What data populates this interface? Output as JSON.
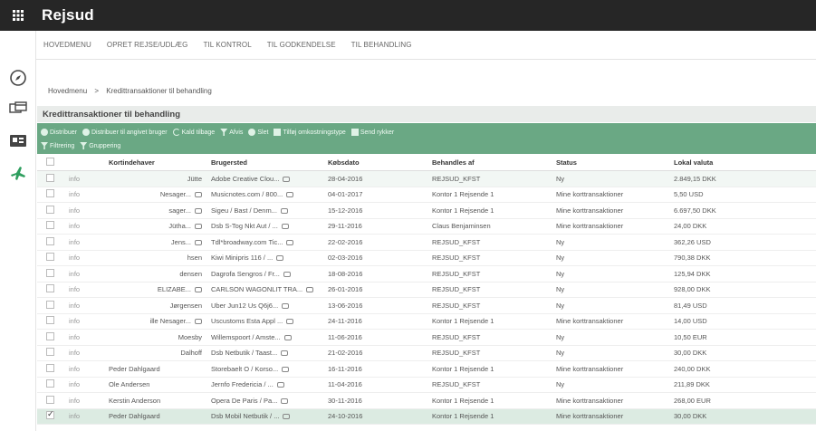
{
  "app": {
    "title": "Rejsud",
    "grid_icon": "grid-icon"
  },
  "menu": {
    "items": [
      "HOVEDMENU",
      "OPRET REJSE/UDLÆG",
      "TIL KONTROL",
      "TIL GODKENDELSE",
      "TIL BEHANDLING"
    ]
  },
  "sidebar": {
    "icons": [
      "compass-icon",
      "cards-icon",
      "card-reader-icon",
      "plane-icon"
    ],
    "accent": "#2e9e5e"
  },
  "breadcrumb": {
    "home": "Hovedmenu",
    "separator": ">",
    "current": "Kredittransaktioner til behandling"
  },
  "panel": {
    "title": "Kredittransaktioner til behandling",
    "toolbar_color": "#6aa884"
  },
  "toolbar": {
    "row1": [
      "Distribuer",
      "Distribuer til angivet bruger",
      "Kald tilbage",
      "Afvis",
      "Slet",
      "Tilføj omkostningstype",
      "Send rykker"
    ],
    "row2": [
      "Filtrering",
      "Gruppering"
    ]
  },
  "table": {
    "headers": [
      "Kortindehaver",
      "Brugersted",
      "Købsdato",
      "Behandles af",
      "Status",
      "Lokal valuta"
    ],
    "rows": [
      {
        "checked": false,
        "info": "info",
        "name": "Jütte",
        "place": "Adobe Creative Clou...",
        "date": "28-04-2016",
        "handler": "REJSUD_KFST",
        "status": "Ny",
        "amount": "2.849,15 DKK"
      },
      {
        "checked": false,
        "info": "info",
        "name": "Nesager...",
        "place": "Musicnotes.com / 800...",
        "date": "04-01-2017",
        "handler": "Kontor 1 Rejsende 1",
        "status": "Mine korttransaktioner",
        "amount": "5,50 USD"
      },
      {
        "checked": false,
        "info": "info",
        "name": "sager...",
        "place": "Sigeu / Bast / Denm...",
        "date": "15-12-2016",
        "handler": "Kontor 1 Rejsende 1",
        "status": "Mine korttransaktioner",
        "amount": "6.697,50 DKK"
      },
      {
        "checked": false,
        "info": "info",
        "name": "Jütha...",
        "place": "Dsb S-Tog Nkt Aut / ...",
        "date": "29-11-2016",
        "handler": "Claus Benjaminsen",
        "status": "Mine korttransaktioner",
        "amount": "24,00 DKK"
      },
      {
        "checked": false,
        "info": "info",
        "name": "Jens...",
        "place": "Tdl*broadway.com Tic...",
        "date": "22-02-2016",
        "handler": "REJSUD_KFST",
        "status": "Ny",
        "amount": "362,26 USD"
      },
      {
        "checked": false,
        "info": "info",
        "name": "hsen",
        "place": "Kiwi Minipris 116 / ...",
        "date": "02-03-2016",
        "handler": "REJSUD_KFST",
        "status": "Ny",
        "amount": "790,38 DKK"
      },
      {
        "checked": false,
        "info": "info",
        "name": "densen",
        "place": "Dagrofa Sengros / Fr...",
        "date": "18-08-2016",
        "handler": "REJSUD_KFST",
        "status": "Ny",
        "amount": "125,94 DKK"
      },
      {
        "checked": false,
        "info": "info",
        "name": "ELIZABE...",
        "place": "CARLSON WAGONLIT TRA...",
        "date": "26-01-2016",
        "handler": "REJSUD_KFST",
        "status": "Ny",
        "amount": "928,00 DKK"
      },
      {
        "checked": false,
        "info": "info",
        "name": "Jørgensen",
        "place": "Uber Jun12 Us Q6j6...",
        "date": "13-06-2016",
        "handler": "REJSUD_KFST",
        "status": "Ny",
        "amount": "81,49 USD"
      },
      {
        "checked": false,
        "info": "info",
        "name": "ille Nesager...",
        "place": "Uscustoms Esta Appl ...",
        "date": "24-11-2016",
        "handler": "Kontor 1 Rejsende 1",
        "status": "Mine korttransaktioner",
        "amount": "14,00 USD"
      },
      {
        "checked": false,
        "info": "info",
        "name": "Moesby",
        "place": "Willemspoort / Amste...",
        "date": "11-06-2016",
        "handler": "REJSUD_KFST",
        "status": "Ny",
        "amount": "10,50 EUR"
      },
      {
        "checked": false,
        "info": "info",
        "name": "Dalhoff",
        "place": "Dsb Netbutik / Taast...",
        "date": "21-02-2016",
        "handler": "REJSUD_KFST",
        "status": "Ny",
        "amount": "30,00 DKK"
      },
      {
        "checked": false,
        "info": "info",
        "name": "Peder Dahlgaard",
        "place": "Storebaelt O / Korso...",
        "date": "16-11-2016",
        "handler": "Kontor 1 Rejsende 1",
        "status": "Mine korttransaktioner",
        "amount": "240,00 DKK"
      },
      {
        "checked": false,
        "info": "info",
        "name": "Ole Andersen",
        "place": "Jernfo Fredericia / ...",
        "date": "11-04-2016",
        "handler": "REJSUD_KFST",
        "status": "Ny",
        "amount": "211,89 DKK"
      },
      {
        "checked": false,
        "info": "info",
        "name": "Kerstin Anderson",
        "place": "Opera De Paris / Pa...",
        "date": "30-11-2016",
        "handler": "Kontor 1 Rejsende 1",
        "status": "Mine korttransaktioner",
        "amount": "268,00 EUR"
      },
      {
        "checked": true,
        "info": "info",
        "name": "Peder Dahlgaard",
        "place": "Dsb Mobil Netbutik / ...",
        "date": "24-10-2016",
        "handler": "Kontor 1 Rejsende 1",
        "status": "Mine korttransaktioner",
        "amount": "30,00 DKK"
      }
    ]
  }
}
